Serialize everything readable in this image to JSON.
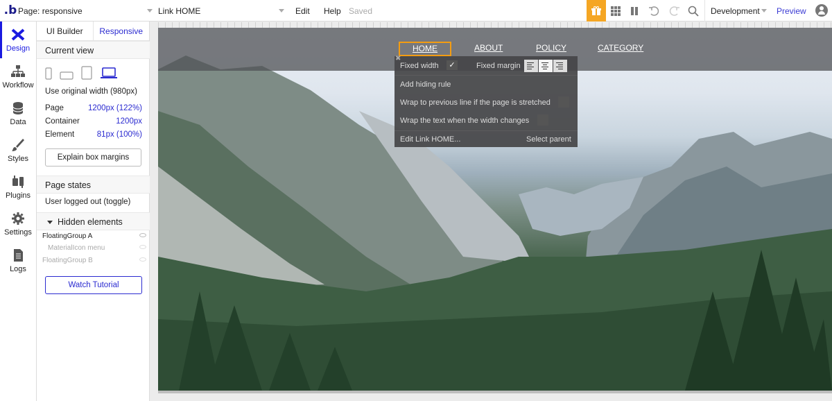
{
  "topbar": {
    "logo": ".b",
    "page_select": "Page: responsive",
    "element_select": "Link HOME",
    "menu": {
      "edit": "Edit",
      "help": "Help",
      "saved": "Saved"
    },
    "environment": "Development",
    "preview": "Preview",
    "icons": [
      "gift-icon",
      "grid-icon",
      "pause-icon",
      "undo-icon",
      "redo-icon",
      "search-icon",
      "account-icon"
    ]
  },
  "leftnav": {
    "items": [
      {
        "label": "Design",
        "icon": "design-icon"
      },
      {
        "label": "Workflow",
        "icon": "workflow-icon"
      },
      {
        "label": "Data",
        "icon": "database-icon"
      },
      {
        "label": "Styles",
        "icon": "brush-icon"
      },
      {
        "label": "Plugins",
        "icon": "plug-icon"
      },
      {
        "label": "Settings",
        "icon": "gear-icon"
      },
      {
        "label": "Logs",
        "icon": "document-icon"
      }
    ],
    "active_color": "#1a1ae0"
  },
  "panel": {
    "tabs": {
      "ui_builder": "UI Builder",
      "responsive": "Responsive"
    },
    "current_view": "Current view",
    "use_original": "Use original width (980px)",
    "page_label": "Page",
    "page_value": "1200px (122%)",
    "container_label": "Container",
    "container_value": "1200px",
    "element_label": "Element",
    "element_value": "81px (100%)",
    "explain_button": "Explain box margins",
    "page_states": "Page states",
    "user_state": "User logged out (toggle)",
    "hidden_elements": "Hidden elements",
    "tree": [
      "FloatingGroup A",
      "MaterialIcon menu",
      "FloatingGroup B"
    ],
    "tutorial_button": "Watch Tutorial"
  },
  "canvas": {
    "nav_links": [
      "HOME",
      "ABOUT",
      "POLICY",
      "CATEGORY"
    ],
    "selected_color": "#f39c12"
  },
  "popup": {
    "fixed_width": "Fixed width",
    "fixed_margin": "Fixed margin",
    "add_hiding_rule": "Add hiding rule",
    "wrap_previous": "Wrap to previous line if the page is stretched",
    "wrap_text": "Wrap the text when the width changes",
    "edit_link": "Edit Link HOME...",
    "select_parent": "Select parent",
    "checkmark": "✓",
    "close": "✖"
  }
}
